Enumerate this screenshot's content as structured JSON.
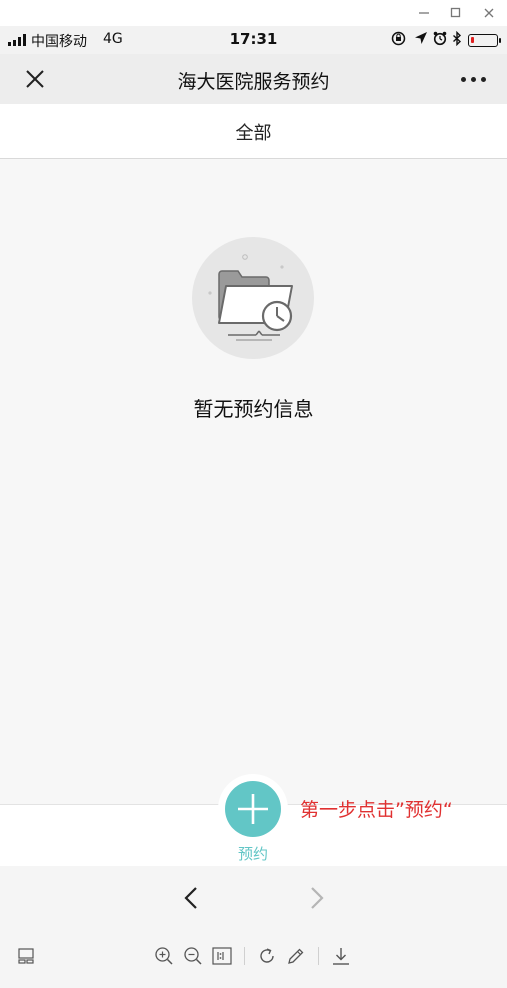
{
  "status_bar": {
    "carrier": "中国移动",
    "network": "4G",
    "time": "17:31"
  },
  "header": {
    "title": "海大医院服务预约"
  },
  "tabs": [
    {
      "label": "全部"
    }
  ],
  "empty_state": {
    "message": "暂无预约信息"
  },
  "action": {
    "book_label": "预约"
  },
  "annotation": {
    "hint": "第一步点击”预约“"
  },
  "colors": {
    "accent": "#62c6c6",
    "hint_red": "#e03131"
  },
  "icons": {
    "window": [
      "minimize-icon",
      "maximize-icon",
      "close-window-icon"
    ],
    "status": [
      "signal-icon",
      "rotation-lock-icon",
      "location-icon",
      "alarm-icon",
      "bluetooth-icon",
      "battery-icon"
    ],
    "header": [
      "close-icon",
      "more-icon"
    ],
    "empty": "empty-folder-clock-icon",
    "fab": "plus-icon",
    "browser": [
      "back-arrow-icon",
      "forward-arrow-icon"
    ],
    "toolbar": [
      "layout-icon",
      "zoom-in-icon",
      "zoom-out-icon",
      "actual-size-icon",
      "rotate-icon",
      "edit-icon",
      "download-icon"
    ]
  }
}
